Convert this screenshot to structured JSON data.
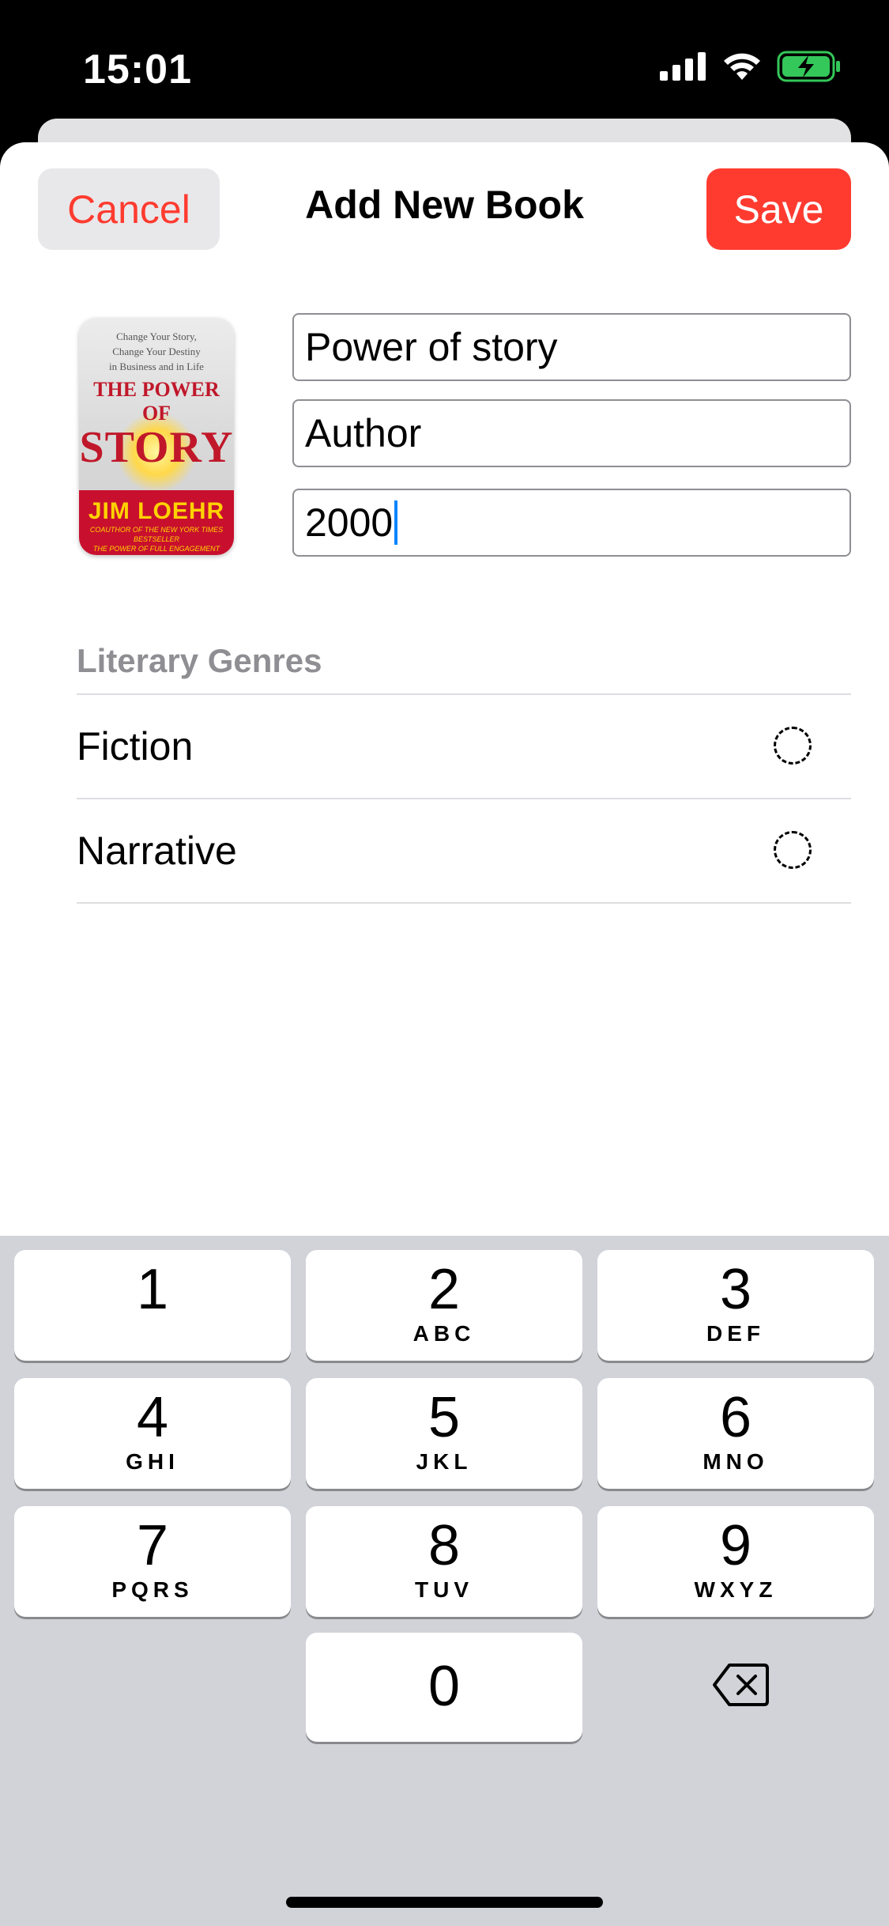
{
  "status_bar": {
    "time": "15:01",
    "icons": [
      "signal-icon",
      "wifi-icon",
      "battery-charging-icon"
    ],
    "battery_color": "#34c759"
  },
  "nav": {
    "cancel_label": "Cancel",
    "title": "Add New Book",
    "save_label": "Save"
  },
  "colors": {
    "accent": "#ff3b30",
    "caret": "#0a84ff",
    "keyboard_bg": "#d1d3d9",
    "section_header": "#8e8e93"
  },
  "cover": {
    "subtitle_lines": [
      "Change Your Story,",
      "Change Your Destiny",
      "in Business and in Life"
    ],
    "title_line1": "THE POWER OF",
    "title_line2": "STORY",
    "author": "JIM LOEHR",
    "note_line1": "COAUTHOR OF THE NEW YORK TIMES BESTSELLER",
    "note_line2": "THE POWER OF FULL ENGAGEMENT"
  },
  "form": {
    "title_value": "Power of story",
    "author_value": "Author",
    "year_value": "2000"
  },
  "genres": {
    "header": "Literary Genres",
    "items": [
      {
        "label": "Fiction",
        "selected": false
      },
      {
        "label": "Narrative",
        "selected": false
      }
    ]
  },
  "keypad": {
    "keys": [
      {
        "digit": "1",
        "letters": ""
      },
      {
        "digit": "2",
        "letters": "ABC"
      },
      {
        "digit": "3",
        "letters": "DEF"
      },
      {
        "digit": "4",
        "letters": "GHI"
      },
      {
        "digit": "5",
        "letters": "JKL"
      },
      {
        "digit": "6",
        "letters": "MNO"
      },
      {
        "digit": "7",
        "letters": "PQRS"
      },
      {
        "digit": "8",
        "letters": "TUV"
      },
      {
        "digit": "9",
        "letters": "WXYZ"
      },
      {
        "digit": "0",
        "letters": ""
      }
    ],
    "delete_icon": "delete-backspace-icon"
  }
}
